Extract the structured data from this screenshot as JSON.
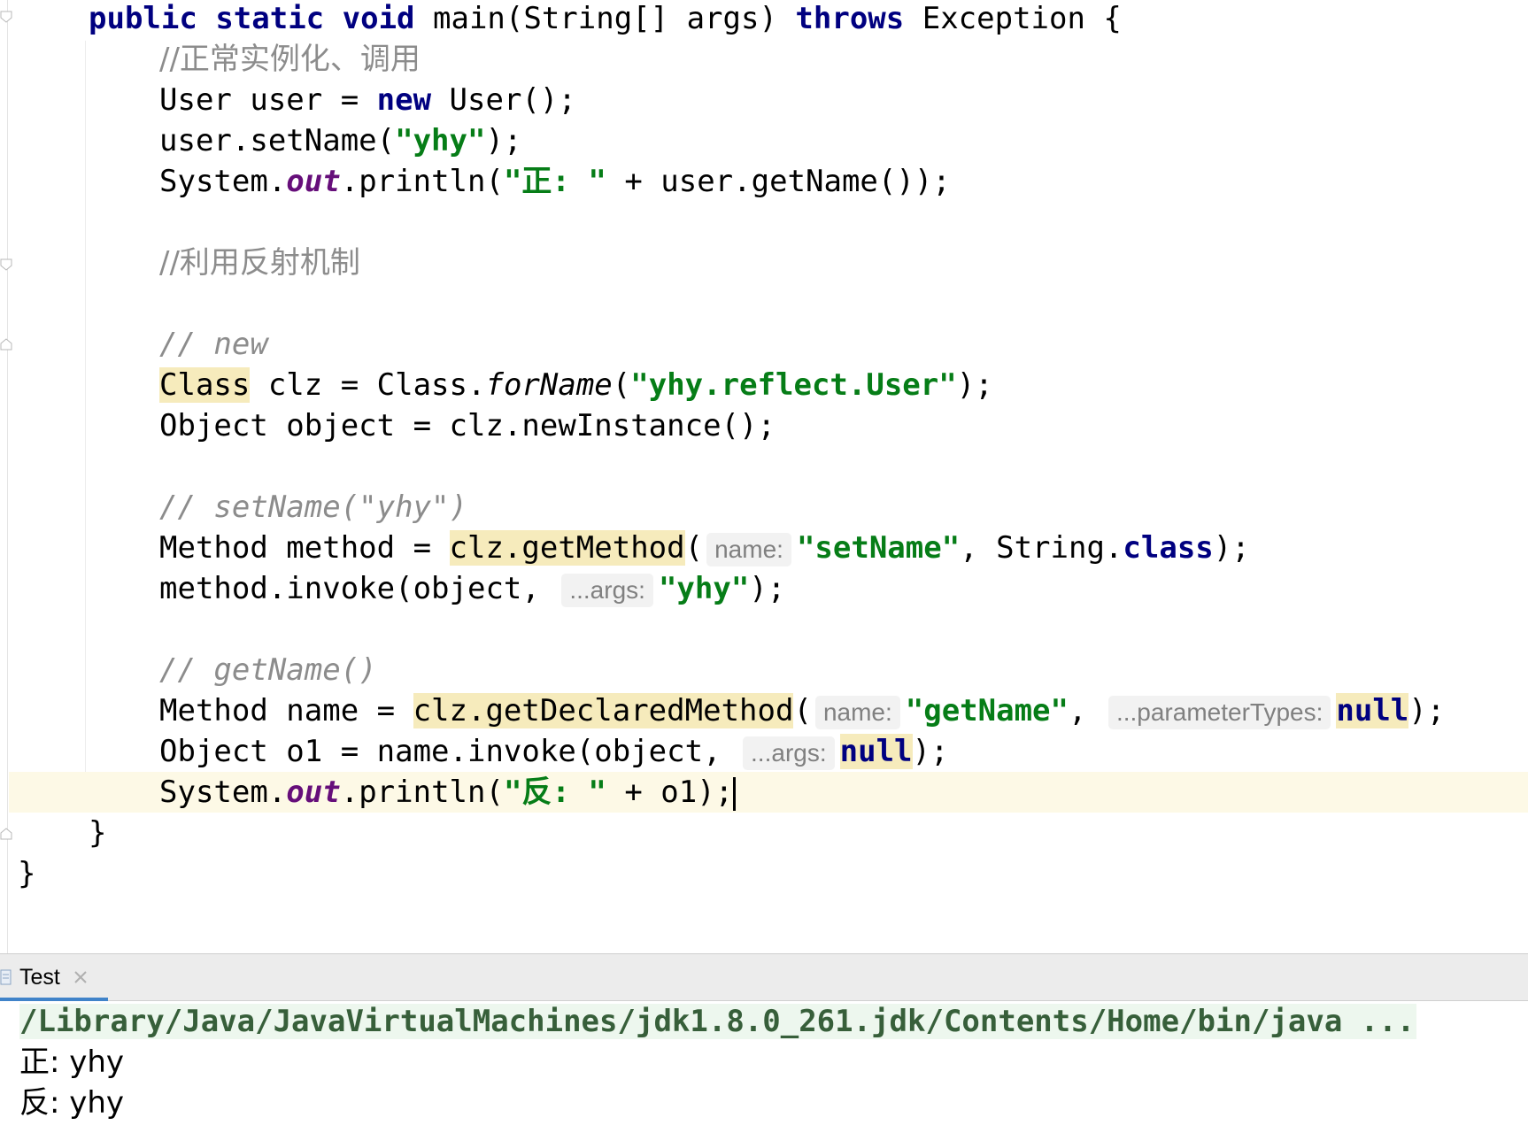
{
  "editor": {
    "method_signature": {
      "kw_public": "public",
      "kw_static": "static",
      "kw_void": "void",
      "name_params": "main(String[] args)",
      "kw_throws": "throws",
      "rest": "Exception {"
    },
    "comment_normal": "//正常实例化、调用",
    "line_new_user": {
      "a": "User user = ",
      "kw": "new",
      "b": "User();"
    },
    "line_set_name": {
      "a": "user.setName(",
      "s": "\"yhy\"",
      "b": ");"
    },
    "line_print_1": {
      "a": "System.",
      "field": "out",
      "b": ".println(",
      "s": "\"正: \"",
      "c": " + user.getName());"
    },
    "comment_reflect": "//利用反射机制",
    "comment_new": "// new",
    "line_forname": {
      "cls": "Class",
      "a": " clz = Class.",
      "m": "forName",
      "b": "(",
      "s": "\"yhy.reflect.User\"",
      "c": ");"
    },
    "line_newinstance": "Object object = clz.newInstance();",
    "comment_setname": "// setName(\"yhy\")",
    "line_getmethod": {
      "a": "Method method = ",
      "call": "clz.getMethod",
      "b": "(",
      "hint": "name:",
      "s": "\"setName\"",
      "c": ", String.",
      "kw": "class",
      "d": ");"
    },
    "line_invoke_1": {
      "a": "method.invoke(object, ",
      "hint": "...args:",
      "s": "\"yhy\"",
      "b": ");"
    },
    "comment_getname": "// getName()",
    "line_getdeclared": {
      "a": "Method name = ",
      "call": "clz.getDeclaredMethod",
      "b": "(",
      "hint1": "name:",
      "s": "\"getName\"",
      "c": ", ",
      "hint2": "...parameterTypes:",
      "kw": "null",
      "d": ");"
    },
    "line_invoke_2": {
      "a": "Object o1 = name.invoke(object, ",
      "hint": "...args:",
      "kw": "null",
      "b": ");"
    },
    "line_print_2": {
      "a": "System.",
      "field": "out",
      "b": ".println(",
      "s": "\"反: \"",
      "c": " + o1);"
    },
    "close_method": "}",
    "close_class": "}"
  },
  "run_panel": {
    "tab_label": "Test",
    "tab_icon": "run-config-icon",
    "close_icon": "close-icon",
    "command": "/Library/Java/JavaVirtualMachines/jdk1.8.0_261.jdk/Contents/Home/bin/java ...",
    "output_lines": [
      "正: yhy",
      "反: yhy"
    ]
  },
  "colors": {
    "keyword": "#000080",
    "string": "#067d17",
    "comment": "#8c8c8c",
    "static_field": "#660e7a",
    "usage_highlight": "#f6ebbc",
    "current_line": "#fdf9e6",
    "tab_underline": "#4083c9"
  }
}
